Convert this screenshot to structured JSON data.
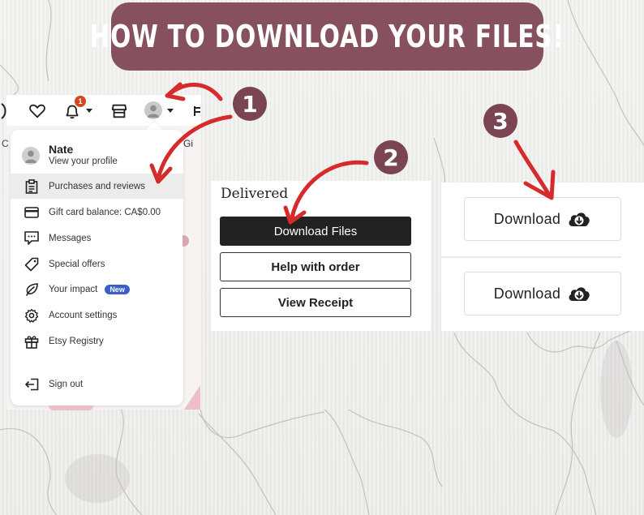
{
  "title": "How to download your files!",
  "steps": [
    "1",
    "2",
    "3"
  ],
  "colors": {
    "banner": "#86505e",
    "badge": "#7a4452",
    "arrow": "#d62b2b",
    "notification": "#d9451a",
    "new_badge": "#3a5fc7"
  },
  "etsy_header": {
    "icons": [
      "favorites-heart-icon",
      "notifications-bell-icon",
      "shop-store-icon",
      "account-avatar-icon",
      "cart-icon"
    ],
    "notification_count": "1",
    "partial_left_text": "C",
    "partial_right_text": "Gi"
  },
  "account_menu": {
    "profile": {
      "name": "Nate",
      "subtitle": "View your profile"
    },
    "items": [
      {
        "label": "Purchases and reviews",
        "icon": "clipboard-icon",
        "active": true
      },
      {
        "label": "Gift card balance: CA$0.00",
        "icon": "credit-card-icon"
      },
      {
        "label": "Messages",
        "icon": "message-icon"
      },
      {
        "label": "Special offers",
        "icon": "tag-icon"
      },
      {
        "label": "Your impact",
        "icon": "leaf-icon",
        "badge": "New"
      },
      {
        "label": "Account settings",
        "icon": "gear-icon"
      },
      {
        "label": "Etsy Registry",
        "icon": "gift-icon"
      },
      {
        "label": "Sign out",
        "icon": "sign-out-icon"
      }
    ]
  },
  "order_panel": {
    "status": "Delivered",
    "buttons": {
      "download_files": "Download Files",
      "help": "Help with order",
      "receipt": "View Receipt"
    }
  },
  "download_panel": {
    "buttons": [
      "Download",
      "Download"
    ]
  }
}
